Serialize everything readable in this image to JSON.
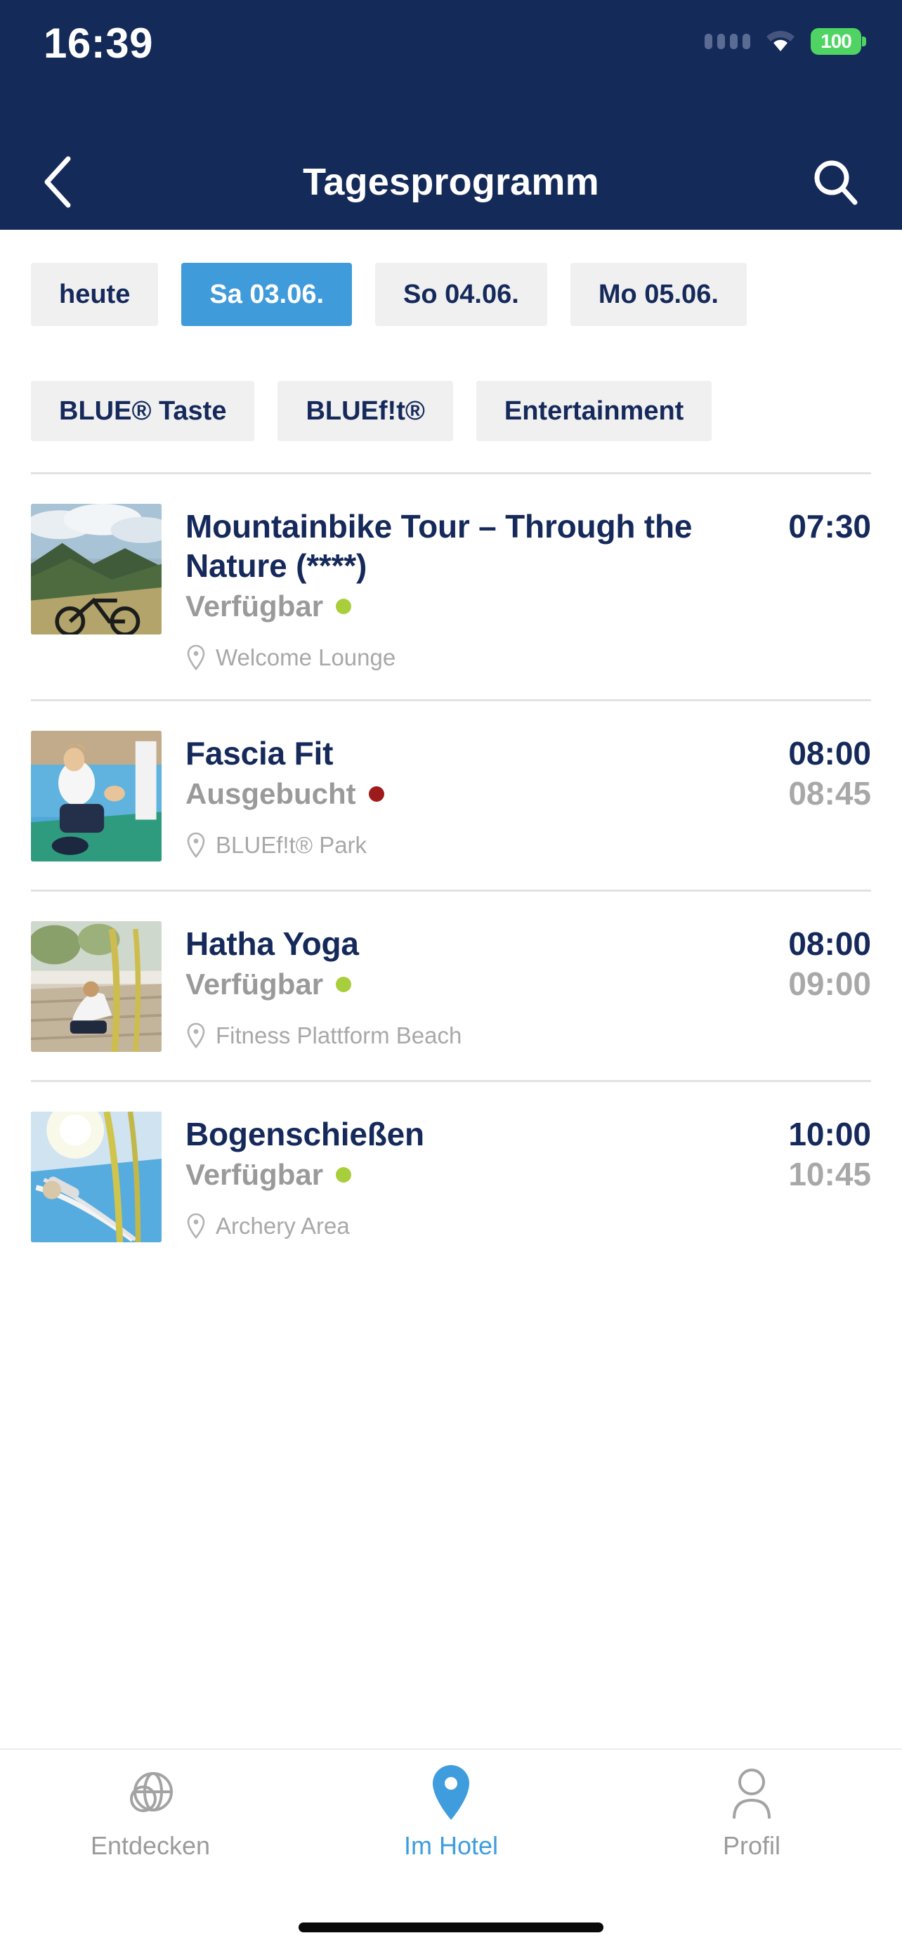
{
  "status_bar": {
    "time": "16:39",
    "battery_level": "100",
    "icons": [
      "signal-dots-icon",
      "wifi-icon",
      "battery-icon"
    ],
    "colors": {
      "background": "#142a58",
      "battery_green": "#4fd463"
    }
  },
  "nav_bar": {
    "title": "Tagesprogramm",
    "back_icon": "chevron-left-icon",
    "search_icon": "search-icon",
    "background": "#142a58"
  },
  "date_tabs": [
    {
      "label": "heute",
      "selected": false
    },
    {
      "label": "Sa 03.06.",
      "selected": true
    },
    {
      "label": "So 04.06.",
      "selected": false
    },
    {
      "label": "Mo 05.06.",
      "selected": false
    }
  ],
  "category_tabs": [
    {
      "label": "BLUE® Taste",
      "selected": false
    },
    {
      "label": "BLUEf!t®",
      "selected": false
    },
    {
      "label": "Entertainment",
      "selected": false
    }
  ],
  "colors": {
    "navy": "#15295b",
    "accent_blue": "#409bdb",
    "chip_grey": "#f0f0f0",
    "available_green": "#a9ce3c",
    "booked_red": "#9e1b1b",
    "muted_text": "#9a9a9a",
    "location_text": "#a8a8a8"
  },
  "activities": [
    {
      "title": "Mountainbike Tour – Through the Nature (****)",
      "status": "Verfügbar",
      "status_color": "#a9ce3c",
      "location": "Welcome Lounge",
      "location_icon": "map-pin-icon",
      "time_start": "07:30",
      "time_end": "",
      "thumbnail": "mountainbike-photo"
    },
    {
      "title": "Fascia Fit",
      "status": "Ausgebucht",
      "status_color": "#9e1b1b",
      "location": "BLUEf!t® Park",
      "location_icon": "map-pin-icon",
      "time_start": "08:00",
      "time_end": "08:45",
      "thumbnail": "fascia-fit-photo"
    },
    {
      "title": "Hatha Yoga",
      "status": "Verfügbar",
      "status_color": "#a9ce3c",
      "location": "Fitness Plattform Beach",
      "location_icon": "map-pin-icon",
      "time_start": "08:00",
      "time_end": "09:00",
      "thumbnail": "hatha-yoga-photo"
    },
    {
      "title": "Bogenschießen",
      "status": "Verfügbar",
      "status_color": "#a9ce3c",
      "location": "Archery Area",
      "location_icon": "map-pin-icon",
      "time_start": "10:00",
      "time_end": "10:45",
      "thumbnail": "archery-photo"
    }
  ],
  "tab_bar": [
    {
      "label": "Entdecken",
      "icon": "globe-icon",
      "active": false
    },
    {
      "label": "Im Hotel",
      "icon": "map-pin-filled-icon",
      "active": true
    },
    {
      "label": "Profil",
      "icon": "person-icon",
      "active": false
    }
  ]
}
